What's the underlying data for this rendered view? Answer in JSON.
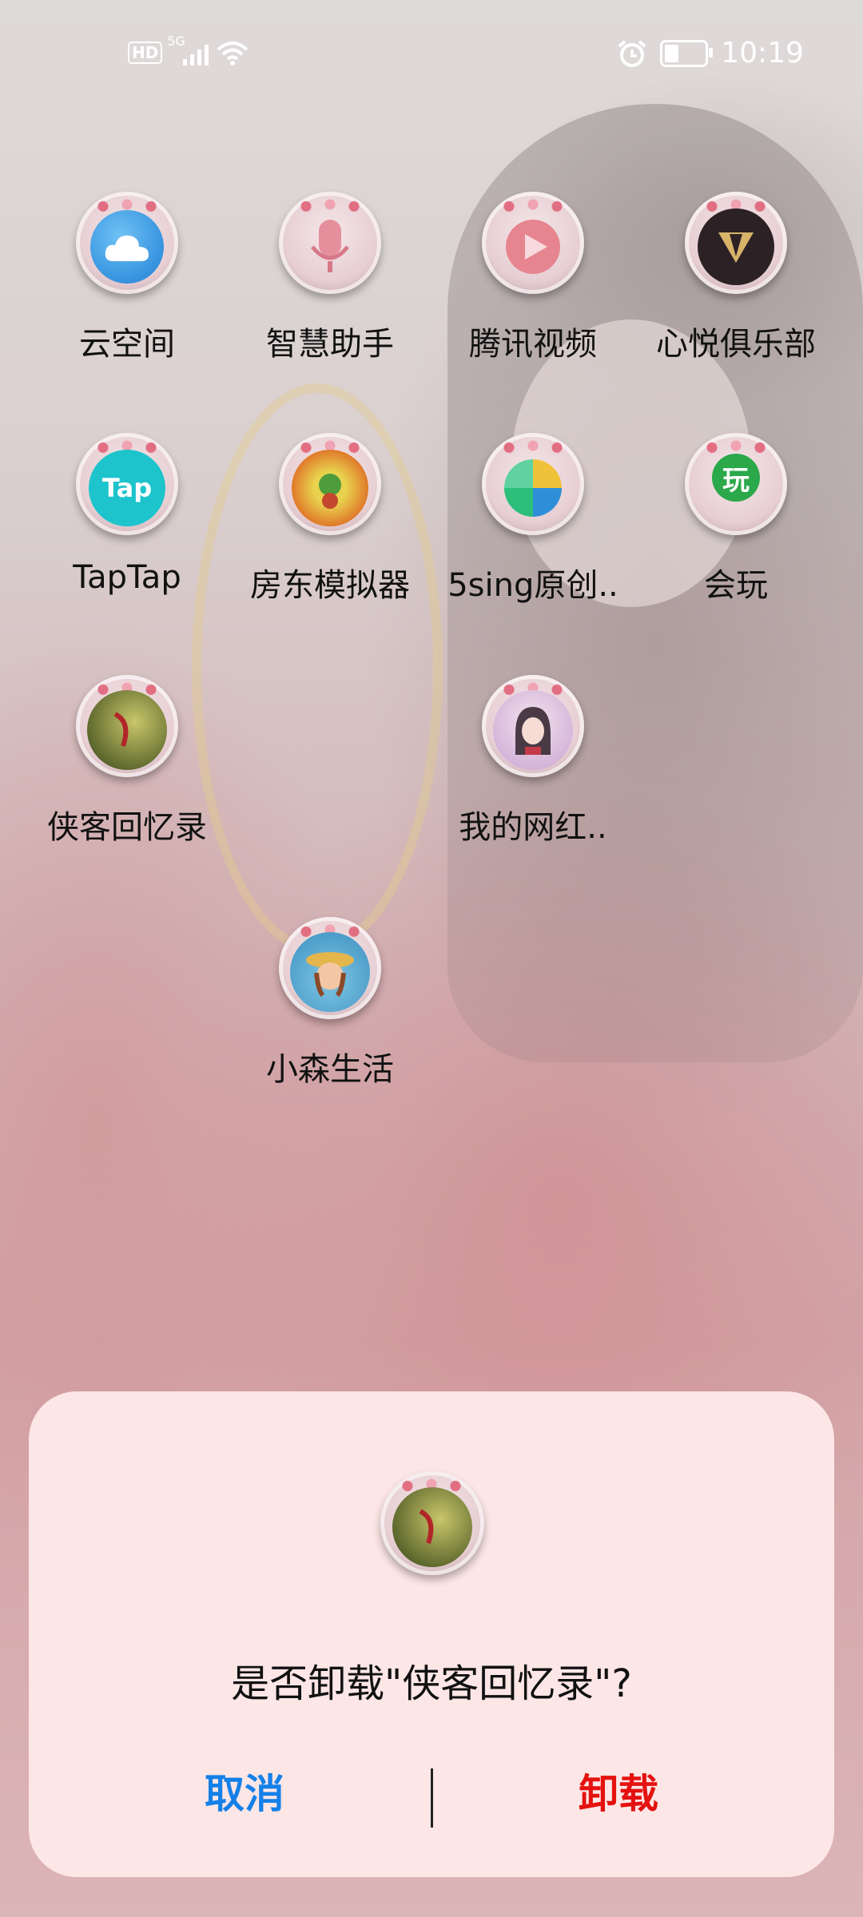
{
  "status_bar": {
    "hd": "HD",
    "network": "5G",
    "time": "10:19",
    "battery_level": 0.34,
    "icons": [
      "hd-icon",
      "signal-icon",
      "wifi-icon",
      "alarm-icon",
      "battery-icon"
    ]
  },
  "apps": [
    {
      "label": "云空间",
      "icon": "cloud-icon"
    },
    {
      "label": "智慧助手",
      "icon": "microphone-icon"
    },
    {
      "label": "腾讯视频",
      "icon": "play-icon"
    },
    {
      "label": "心悦俱乐部",
      "icon": "heart-club-icon"
    },
    {
      "label": "TapTap",
      "icon": "taptap-icon",
      "glyph": "Tap"
    },
    {
      "label": "房东模拟器",
      "icon": "landlord-game-icon"
    },
    {
      "label": "5sing原创..",
      "icon": "5sing-icon"
    },
    {
      "label": "会玩",
      "icon": "huiwan-icon",
      "glyph": "玩"
    },
    {
      "label": "侠客回忆录",
      "icon": "xiake-game-icon"
    },
    {
      "label": "我的网红..",
      "icon": "anime-girl-icon"
    },
    {
      "label": "小森生活",
      "icon": "xiaosen-game-icon"
    }
  ],
  "dialog": {
    "message": "是否卸载\"侠客回忆录\"?",
    "cancel_label": "取消",
    "uninstall_label": "卸载"
  },
  "colors": {
    "dialog_bg": "#fde6e6",
    "cancel": "#1580e8",
    "uninstall": "#e4120f"
  }
}
